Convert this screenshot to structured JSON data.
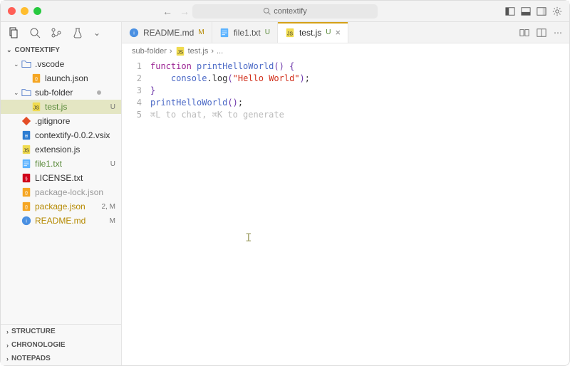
{
  "titlebar": {
    "search_placeholder": "contextify"
  },
  "explorer": {
    "title": "CONTEXTIFY",
    "items": [
      {
        "kind": "folder",
        "label": ".vscode",
        "open": true,
        "indent": 1
      },
      {
        "kind": "file",
        "label": "launch.json",
        "icon": "json",
        "indent": 2,
        "muted": false
      },
      {
        "kind": "folder",
        "label": "sub-folder",
        "open": true,
        "indent": 1,
        "status_dot": true
      },
      {
        "kind": "file",
        "label": "test.js",
        "icon": "js",
        "indent": 2,
        "selected": true,
        "class": "grn",
        "badge": "U"
      },
      {
        "kind": "file",
        "label": ".gitignore",
        "icon": "git",
        "indent": 1
      },
      {
        "kind": "file",
        "label": "contextify-0.0.2.vsix",
        "icon": "vsix",
        "indent": 1
      },
      {
        "kind": "file",
        "label": "extension.js",
        "icon": "js",
        "indent": 1
      },
      {
        "kind": "file",
        "label": "file1.txt",
        "icon": "txt",
        "indent": 1,
        "class": "grn",
        "badge": "U"
      },
      {
        "kind": "file",
        "label": "LICENSE.txt",
        "icon": "lic",
        "indent": 1
      },
      {
        "kind": "file",
        "label": "package-lock.json",
        "icon": "json",
        "indent": 1,
        "muted": true
      },
      {
        "kind": "file",
        "label": "package.json",
        "icon": "json",
        "indent": 1,
        "class": "org",
        "badge": "2, M"
      },
      {
        "kind": "file",
        "label": "README.md",
        "icon": "md",
        "indent": 1,
        "class": "org",
        "badge": "M"
      }
    ]
  },
  "bottom_sections": [
    "STRUCTURE",
    "CHRONOLOGIE",
    "NOTEPADS"
  ],
  "tabs": [
    {
      "icon": "md",
      "label": "README.md",
      "status": "M",
      "status_class": "org"
    },
    {
      "icon": "txt",
      "label": "file1.txt",
      "status": "U",
      "status_class": "grn"
    },
    {
      "icon": "js",
      "label": "test.js",
      "status": "U",
      "status_class": "grn",
      "active": true,
      "closable": true
    }
  ],
  "breadcrumb": [
    "sub-folder",
    "test.js",
    "..."
  ],
  "code": {
    "lines": [
      {
        "n": 1,
        "tokens": [
          [
            "kw",
            "function"
          ],
          [
            "",
            " "
          ],
          [
            "fn",
            "printHelloWorld"
          ],
          [
            "brace",
            "()"
          ],
          [
            "",
            " "
          ],
          [
            "brace",
            "{"
          ]
        ]
      },
      {
        "n": 2,
        "tokens": [
          [
            "",
            "    "
          ],
          [
            "fn",
            "console"
          ],
          [
            "",
            ".log"
          ],
          [
            "brace",
            "("
          ],
          [
            "str",
            "\"Hello World\""
          ],
          [
            "brace",
            ")"
          ],
          [
            "",
            ";"
          ]
        ]
      },
      {
        "n": 3,
        "tokens": [
          [
            "brace",
            "}"
          ]
        ]
      },
      {
        "n": 4,
        "tokens": [
          [
            "fn",
            "printHelloWorld"
          ],
          [
            "brace",
            "()"
          ],
          [
            "",
            ";"
          ]
        ]
      },
      {
        "n": 5,
        "tokens": [
          [
            "ghost",
            "⌘L to chat, ⌘K to generate"
          ]
        ]
      }
    ]
  },
  "icons": {
    "search": "🔍"
  }
}
